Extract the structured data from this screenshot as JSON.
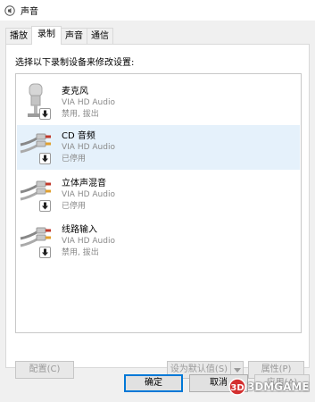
{
  "window": {
    "title": "声音"
  },
  "tabs": [
    {
      "label": "播放",
      "active": false
    },
    {
      "label": "录制",
      "active": true
    },
    {
      "label": "声音",
      "active": false
    },
    {
      "label": "通信",
      "active": false
    }
  ],
  "recording": {
    "instruction": "选择以下录制设备来修改设置:",
    "devices": [
      {
        "name": "麦克风",
        "driver": "VIA HD Audio",
        "status": "禁用, 拔出",
        "icon": "microphone-icon",
        "selected": false
      },
      {
        "name": "CD 音频",
        "driver": "VIA HD Audio",
        "status": "已停用",
        "icon": "line-in-jack-icon",
        "selected": true
      },
      {
        "name": "立体声混音",
        "driver": "VIA HD Audio",
        "status": "已停用",
        "icon": "line-in-jack-icon",
        "selected": false
      },
      {
        "name": "线路输入",
        "driver": "VIA HD Audio",
        "status": "禁用, 拔出",
        "icon": "line-in-jack-icon",
        "selected": false
      }
    ],
    "buttons": {
      "configure": "配置(C)",
      "set_default": "设为默认值(S)",
      "properties": "属性(P)"
    }
  },
  "footer": {
    "ok": "确定",
    "cancel": "取消",
    "apply": "应用(A)"
  },
  "watermark": "3DMGAME",
  "colors": {
    "selection": "#e5f1fb",
    "accent": "#0078d7"
  }
}
